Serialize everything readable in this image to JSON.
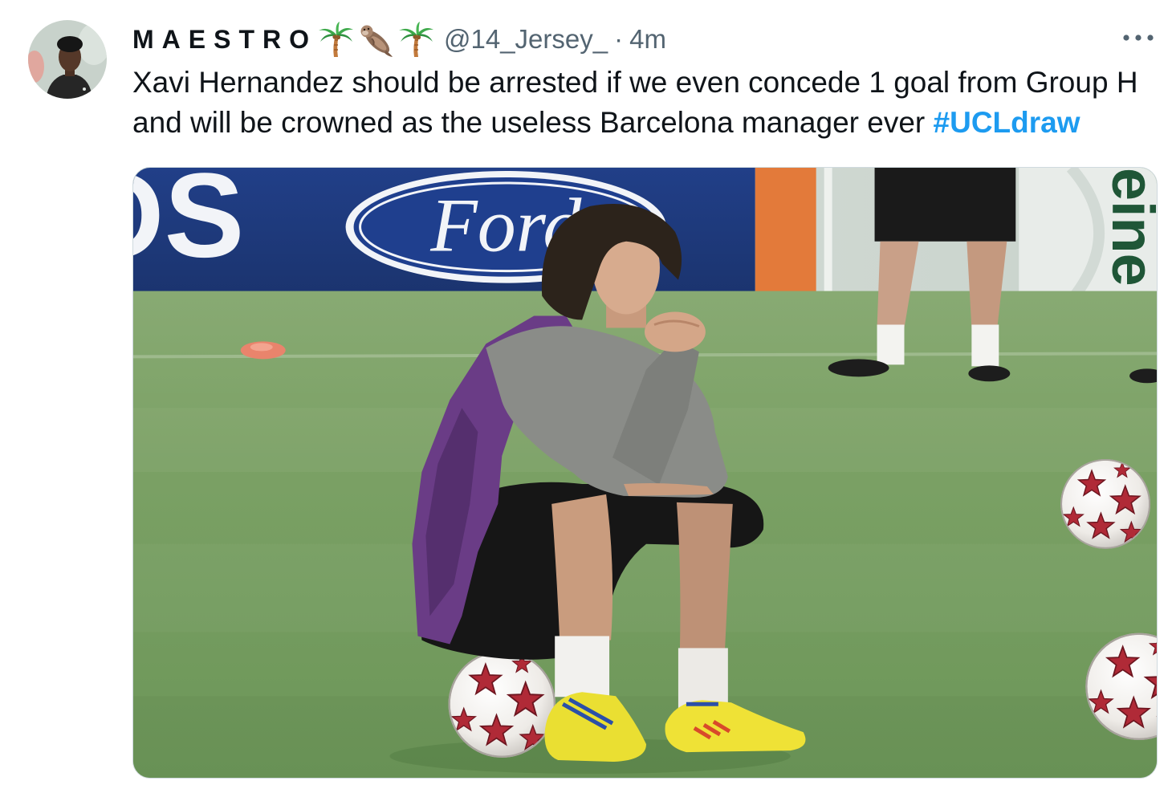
{
  "tweet": {
    "author": {
      "name": "MAESTRO",
      "name_emoji_icons": [
        "palm-tree-icon",
        "otter-icon",
        "palm-tree-icon"
      ],
      "handle": "@14_Jersey_",
      "separator": "·",
      "time": "4m"
    },
    "more_icon": "more-horizontal-icon",
    "text_lines": [
      "Xavi Hernandez should be arrested if we even concede 1 goal from Group H",
      "and will be crowned as the useless Barcelona manager ever"
    ],
    "hashtag": "#UCLdraw",
    "media": {
      "ad_board_text_left": "OS",
      "logo_text": "Ford",
      "ad_board_text_right": "eine"
    }
  },
  "colors": {
    "text": "#0f1419",
    "secondary_text": "#536471",
    "hashtag": "#1d9bf0",
    "media_border": "#cfd9de"
  }
}
